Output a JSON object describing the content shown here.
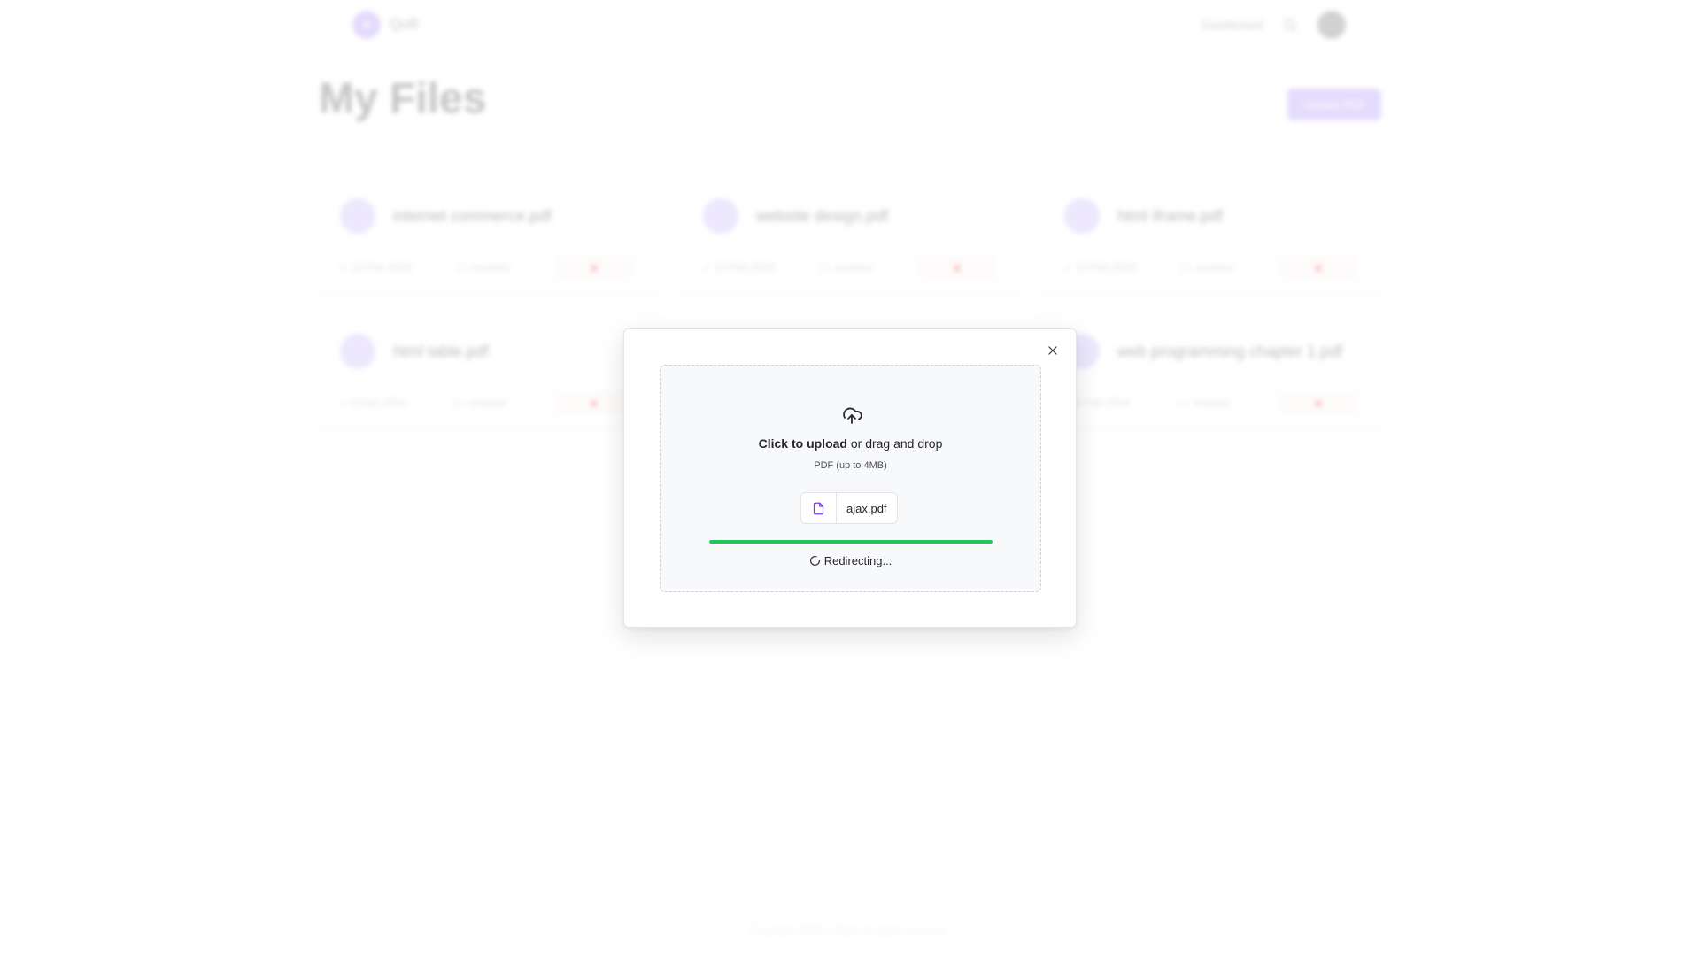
{
  "navbar": {
    "brand_name": "Quill",
    "brand_icon": "logo-icon",
    "links": [
      "Dashboard"
    ],
    "search_icon": "search-icon"
  },
  "page": {
    "title": "My Files",
    "upload_button_label": "Upload PDF"
  },
  "files": [
    {
      "name": "internet commerce.pdf",
      "date": "10 Feb 2024",
      "meta": "mocked"
    },
    {
      "name": "website design.pdf",
      "date": "10 Feb 2024",
      "meta": "mocked"
    },
    {
      "name": "html iframe.pdf",
      "date": "10 Feb 2024",
      "meta": "mocked"
    },
    {
      "name": "html table.pdf",
      "date": "9 Feb 2024",
      "meta": "mocked"
    },
    {
      "name": "web programming chapter 1.pdf",
      "date": "9 Feb 2024",
      "meta": "mocked"
    }
  ],
  "footer": {
    "text": "Copyright 2024 © Quill. All rights reserved."
  },
  "upload_modal": {
    "close_icon": "close-icon",
    "upload_icon": "cloud-upload-icon",
    "prompt_bold": "Click to upload",
    "prompt_rest": " or drag and drop",
    "hint": "PDF (up to 4MB)",
    "file_icon": "file-icon",
    "file_name": "ajax.pdf",
    "progress": 100,
    "progress_color": "#22c55e",
    "status_icon": "loader-icon",
    "status_text": "Redirecting..."
  },
  "colors": {
    "accent": "#a78bfa",
    "danger": "#ef4444",
    "success": "#22c55e"
  }
}
